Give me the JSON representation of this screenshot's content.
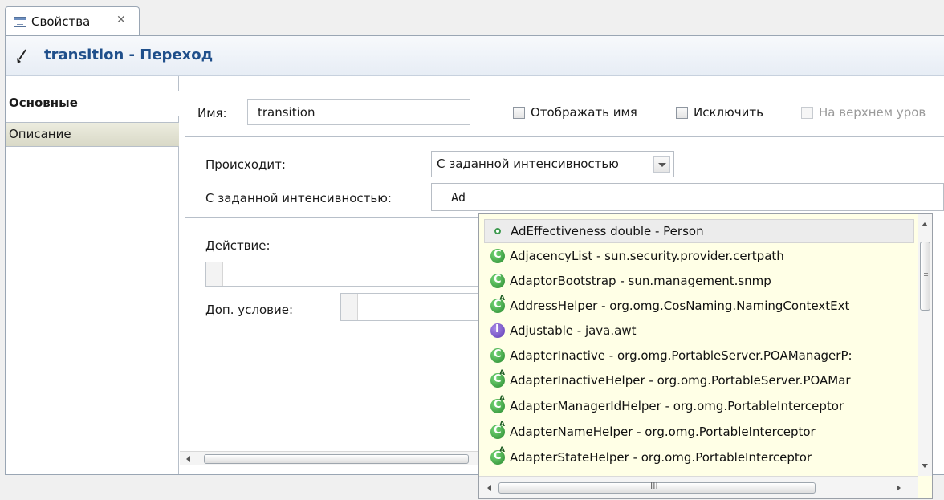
{
  "view_tab": {
    "label": "Свойства",
    "close_glyph": "✕"
  },
  "header": {
    "title": "transition - Переход",
    "icon": "transition-arrow-icon"
  },
  "side_tabs": [
    {
      "label": "Основные",
      "active": true
    },
    {
      "label": "Описание",
      "active": false
    }
  ],
  "form": {
    "name_label": "Имя:",
    "name_value": "transition",
    "show_name_label": "Отображать имя",
    "exclude_label": "Исключить",
    "top_level_label": "На верхнем уров",
    "occurs_label": "Происходит:",
    "occurs_value": "С заданной интенсивностью",
    "rate_label": "С заданной интенсивностью:",
    "rate_value": "Ad",
    "action_label": "Действие:",
    "condition_label": "Доп. условие:"
  },
  "autocomplete": {
    "items": [
      {
        "text": "AdEffectiveness   double - Person",
        "icon": "field-icon",
        "selected": true
      },
      {
        "text": "AdjacencyList - sun.security.provider.certpath",
        "icon": "class-icon"
      },
      {
        "text": "AdaptorBootstrap - sun.management.snmp",
        "icon": "class-icon"
      },
      {
        "text": "AddressHelper - org.omg.CosNaming.NamingContextExt",
        "icon": "abstract-class-icon"
      },
      {
        "text": "Adjustable - java.awt",
        "icon": "interface-icon"
      },
      {
        "text": "AdapterInactive - org.omg.PortableServer.POAManagerP:",
        "icon": "class-icon"
      },
      {
        "text": "AdapterInactiveHelper - org.omg.PortableServer.POAMar",
        "icon": "abstract-class-icon"
      },
      {
        "text": "AdapterManagerIdHelper - org.omg.PortableInterceptor",
        "icon": "abstract-class-icon"
      },
      {
        "text": "AdapterNameHelper - org.omg.PortableInterceptor",
        "icon": "abstract-class-icon"
      },
      {
        "text": "AdapterStateHelper - org.omg.PortableInterceptor",
        "icon": "abstract-class-icon"
      }
    ],
    "hscroll_thumb_glyph": "III"
  },
  "colors": {
    "header_title": "#1f4f8b",
    "popup_bg": "#ffffe6",
    "side_tab_inactive": "#d9d9c7"
  }
}
